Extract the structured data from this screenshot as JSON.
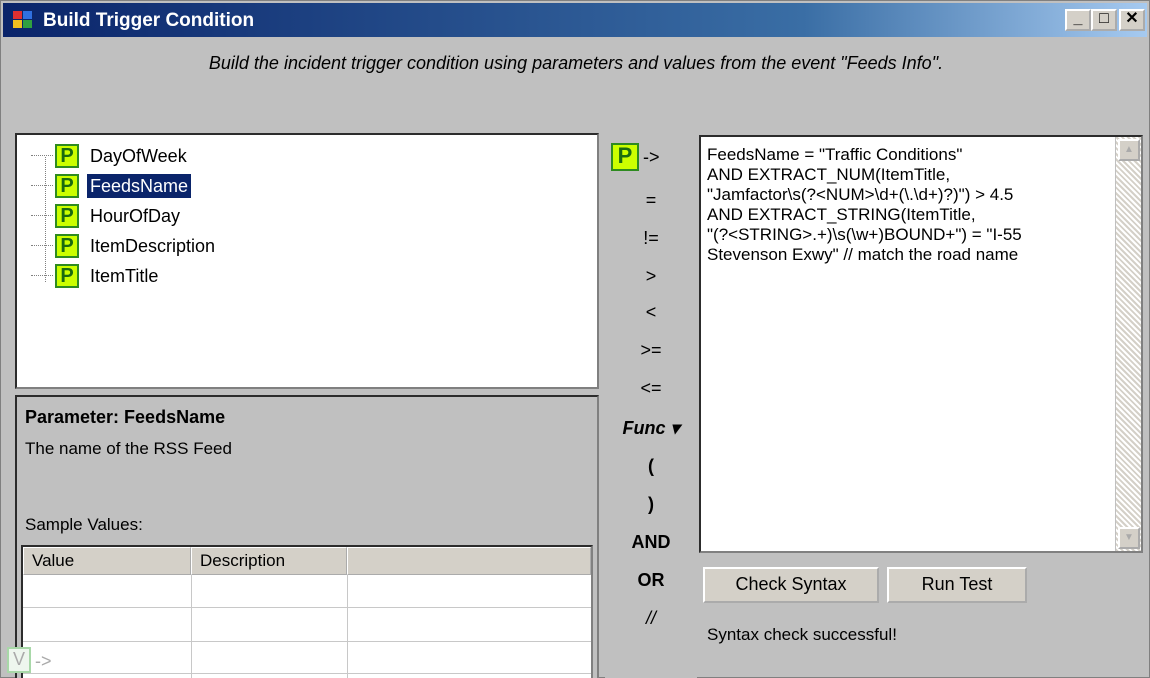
{
  "window": {
    "title": "Build Trigger Condition",
    "minimize": "_",
    "maximize": "□",
    "close": "✕"
  },
  "instruction": "Build the incident trigger condition using parameters and values from the event \"Feeds Info\".",
  "parameters": {
    "icon_letter": "P",
    "items": [
      "DayOfWeek",
      "FeedsName",
      "HourOfDay",
      "ItemDescription",
      "ItemTitle"
    ],
    "selected": "FeedsName"
  },
  "details": {
    "title": "Parameter: FeedsName",
    "description": "The name of the RSS Feed",
    "sample_label": "Sample Values:",
    "columns": [
      "Value",
      "Description"
    ]
  },
  "operators": {
    "insert_param_arrow": "->",
    "eq": "=",
    "ne": "!=",
    "gt": ">",
    "lt": "<",
    "ge": ">=",
    "le": "<=",
    "func": "Func ▾",
    "lparen": "(",
    "rparen": ")",
    "and": "AND",
    "or": "OR",
    "comment": "//",
    "insert_value_letter": "V",
    "insert_value_arrow": "->"
  },
  "editor": {
    "lines": [
      "FeedsName = \"Traffic Conditions\"",
      "AND EXTRACT_NUM(ItemTitle,",
      "\"Jamfactor\\s(?<NUM>\\d+(\\.\\d+)?)\") > 4.5",
      "AND EXTRACT_STRING(ItemTitle,",
      "\"(?<STRING>.+)\\s(\\w+)BOUND+\") = \"I-55",
      "Stevenson Exwy\" // match the road name"
    ]
  },
  "buttons": {
    "check_syntax": "Check Syntax",
    "run_test": "Run Test"
  },
  "status": "Syntax check successful!",
  "colors": {
    "param_icon_bg": "#ccff00",
    "selection": "#0a246a"
  }
}
